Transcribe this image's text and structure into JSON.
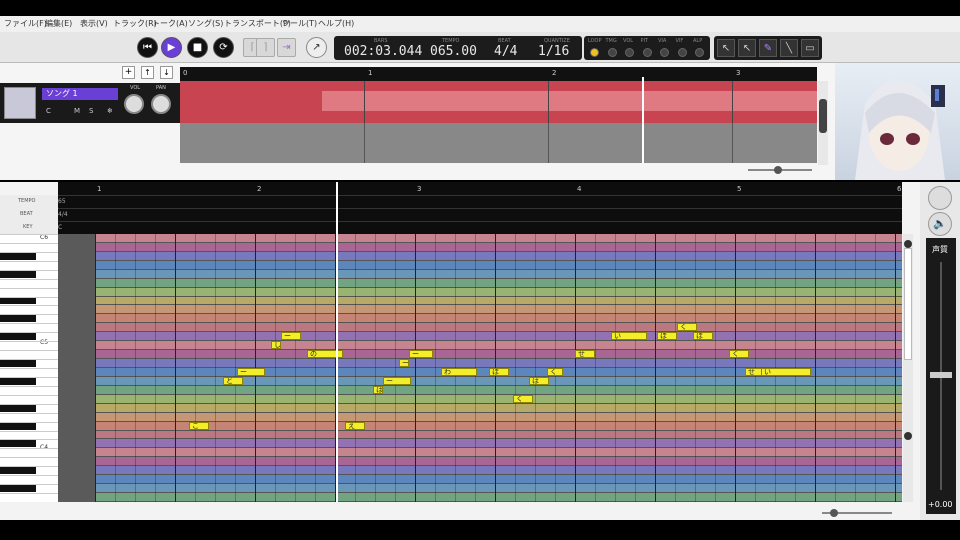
{
  "menu": [
    "ファイル(F)",
    "編集(E)",
    "表示(V)",
    "トラック(R)",
    "トーク(A)",
    "ソング(S)",
    "トランスポート(P)",
    "ツール(T)",
    "ヘルプ(H)"
  ],
  "transport": {
    "bars_label": "BARS",
    "bars_value": "002:03.044",
    "tempo_label": "TEMPO",
    "tempo_value": "065.00",
    "beat_label": "BEAT",
    "beat_value": "4/4",
    "quantize_label": "QUANTIZE",
    "quantize_value": "1/16",
    "knob_labels": [
      "LOOP",
      "TMG",
      "VOL",
      "PIT",
      "VIA",
      "VIF",
      "ALP"
    ]
  },
  "track": {
    "name": "ソング 1",
    "buttons": [
      "C",
      "M",
      "S",
      "❄"
    ],
    "vol_label": "VOL",
    "pan_label": "PAN",
    "ruler": [
      "0",
      "1",
      "2",
      "3"
    ]
  },
  "editor": {
    "rows": [
      "TEMPO",
      "BEAT",
      "KEY"
    ],
    "row_values": [
      "65",
      "4/4",
      "C"
    ],
    "measures": [
      "1",
      "2",
      "3",
      "4",
      "5",
      "6"
    ],
    "keys": [
      "C6",
      "C5",
      "C4"
    ],
    "voice_label": "声質",
    "voice_value": "+0.00"
  },
  "notes": [
    {
      "t": "こ",
      "col": 4.7,
      "len": 1,
      "row": 21
    },
    {
      "t": "と",
      "col": 6.4,
      "len": 1,
      "row": 16
    },
    {
      "t": "ー",
      "col": 7.1,
      "len": 1.4,
      "row": 15
    },
    {
      "t": "し",
      "col": 8.8,
      "len": 0.5,
      "row": 12
    },
    {
      "t": "ー",
      "col": 9.3,
      "len": 1,
      "row": 11
    },
    {
      "t": "の",
      "col": 10.6,
      "len": 1.8,
      "row": 13
    },
    {
      "t": "え",
      "col": 12.5,
      "len": 1,
      "row": 21
    },
    {
      "t": "は",
      "col": 13.9,
      "len": 0.5,
      "row": 17
    },
    {
      "t": "ー",
      "col": 14.4,
      "len": 1.4,
      "row": 16
    },
    {
      "t": "ー",
      "col": 15.2,
      "len": 0.5,
      "row": 14
    },
    {
      "t": "ー",
      "col": 15.7,
      "len": 1.2,
      "row": 13
    },
    {
      "t": "わ",
      "col": 17.3,
      "len": 1.8,
      "row": 15
    },
    {
      "t": "ほ",
      "col": 19.7,
      "len": 1,
      "row": 15
    },
    {
      "t": "く",
      "col": 20.9,
      "len": 1,
      "row": 18
    },
    {
      "t": "は",
      "col": 21.7,
      "len": 1,
      "row": 16
    },
    {
      "t": "く",
      "col": 22.6,
      "len": 0.8,
      "row": 15
    },
    {
      "t": "せ",
      "col": 24.0,
      "len": 1,
      "row": 13
    },
    {
      "t": "い",
      "col": 25.8,
      "len": 1.8,
      "row": 11
    },
    {
      "t": "ほ",
      "col": 28.1,
      "len": 1,
      "row": 11
    },
    {
      "t": "く",
      "col": 29.1,
      "len": 1,
      "row": 10
    },
    {
      "t": "ほ",
      "col": 29.9,
      "len": 1,
      "row": 11
    },
    {
      "t": "く",
      "col": 31.7,
      "len": 1,
      "row": 13
    },
    {
      "t": "せ",
      "col": 32.5,
      "len": 1,
      "row": 15
    },
    {
      "t": "い",
      "col": 33.3,
      "len": 2.5,
      "row": 15
    }
  ],
  "row_colors": [
    "#d98d9a",
    "#b8689f",
    "#7f7fcf",
    "#5f8fcf",
    "#6fa3c9",
    "#79b38a",
    "#a6c477",
    "#c9b86a",
    "#d9a37a",
    "#d98d7a",
    "#cf7f8a",
    "#9f78c4"
  ]
}
